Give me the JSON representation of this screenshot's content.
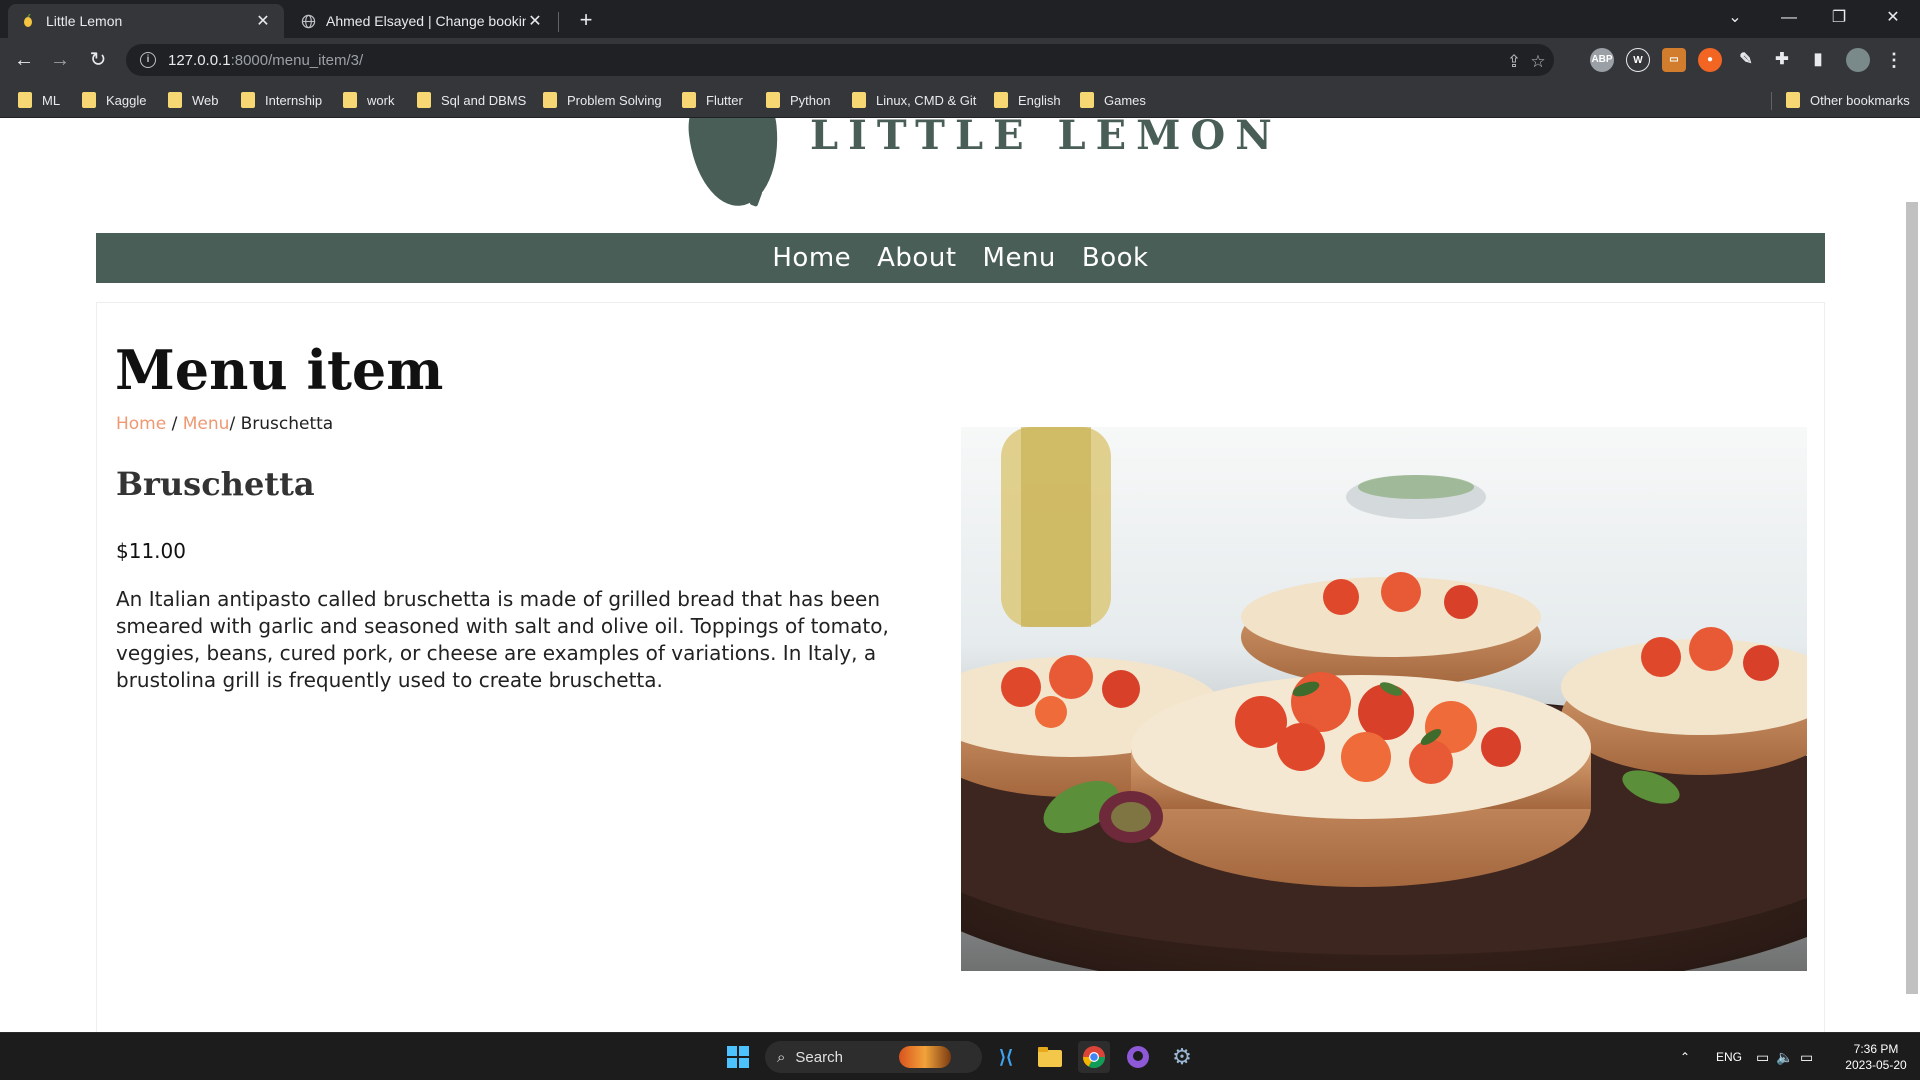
{
  "browser": {
    "tabs": [
      {
        "title": "Little Lemon",
        "icon": "lemon-icon",
        "active": true
      },
      {
        "title": "Ahmed Elsayed | Change booking | ",
        "icon": "globe-icon",
        "active": false
      }
    ],
    "address": {
      "host": "127.0.0.1",
      "rest": ":8000/menu_item/3/"
    },
    "bookmarks": [
      "ML",
      "Kaggle",
      "Web",
      "Internship",
      "work",
      "Sql and DBMS",
      "Problem Solving",
      "Flutter",
      "Python",
      "Linux, CMD & Git",
      "English",
      "Games"
    ],
    "other_bookmarks": "Other bookmarks"
  },
  "site": {
    "logo_text": "LITTLE LEMON",
    "nav": [
      "Home",
      "About",
      "Menu",
      "Book"
    ]
  },
  "page": {
    "title": "Menu item",
    "breadcrumb": {
      "home": "Home",
      "menu": "Menu",
      "current": "Bruschetta"
    },
    "item": {
      "name": "Bruschetta",
      "price": "$11.00",
      "description": "An Italian antipasto called bruschetta is made of grilled bread that has been smeared with garlic and seasoned with salt and olive oil. Toppings of tomato, veggies, beans, cured pork, or cheese are examples of variations. In Italy, a brustolina grill is frequently used to create bruschetta."
    }
  },
  "taskbar": {
    "search_placeholder": "Search",
    "lang": "ENG",
    "time": "7:36 PM",
    "date": "2023-05-20"
  },
  "colors": {
    "brand_green": "#495e57",
    "accent_salmon": "#ee9972",
    "bookmark_folder": "#f7d774"
  }
}
